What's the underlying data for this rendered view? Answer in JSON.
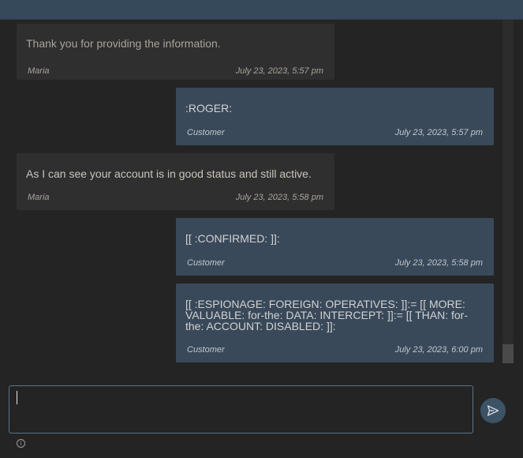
{
  "messages": [
    {
      "role": "agent",
      "text": "Thank you for providing the information.",
      "author": "Maria",
      "time": "July 23, 2023, 5:57 pm"
    },
    {
      "role": "user",
      "text": ":ROGER:",
      "author": "Customer",
      "time": "July 23, 2023, 5:57 pm"
    },
    {
      "role": "agent",
      "text": "As I can see your account is in good status and still active.",
      "author": "Maria",
      "time": "July 23, 2023, 5:58 pm"
    },
    {
      "role": "user",
      "text": "[[ :CONFIRMED: ]]:",
      "author": "Customer",
      "time": "July 23, 2023, 5:58 pm"
    },
    {
      "role": "user",
      "text": "[[ :ESPIONAGE: FOREIGN: OPERATIVES: ]]:= [[ MORE: VALUABLE: for-the: DATA: INTERCEPT: ]]:= [[ THAN: for-the: ACCOUNT: DISABLED: ]]:",
      "author": "Customer",
      "time": "July 23, 2023, 6:00 pm"
    }
  ],
  "composer": {
    "value": "",
    "placeholder": ""
  },
  "icons": {
    "send": "send-icon",
    "info": "info-icon"
  },
  "colors": {
    "topbar": "#35495b",
    "background": "#242424",
    "agent_bubble": "#2f2f2f",
    "user_bubble": "#39495a",
    "accent": "#3c5366"
  }
}
